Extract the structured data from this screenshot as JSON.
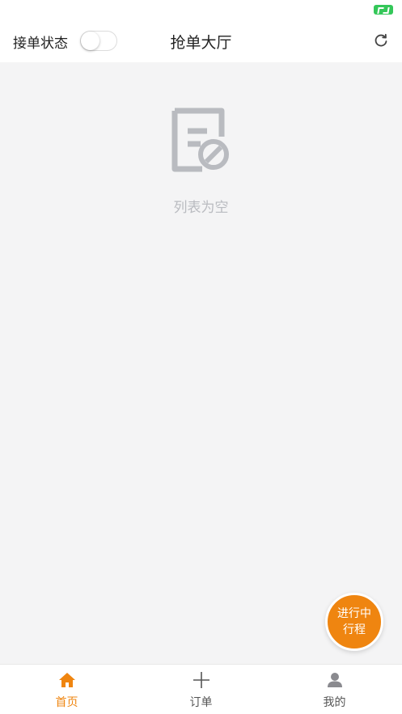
{
  "header": {
    "order_status_label": "接单状态",
    "title": "抢单大厅",
    "toggle_on": false
  },
  "empty_state": {
    "text": "列表为空"
  },
  "floating_button": {
    "line1": "进行中",
    "line2": "行程"
  },
  "tabs": [
    {
      "label": "首页",
      "icon": "home-icon",
      "active": true
    },
    {
      "label": "订单",
      "icon": "plus-icon",
      "active": false
    },
    {
      "label": "我的",
      "icon": "user-icon",
      "active": false
    }
  ],
  "colors": {
    "accent": "#ef8510",
    "battery": "#34c759",
    "empty_gray": "#b9bbc0"
  }
}
